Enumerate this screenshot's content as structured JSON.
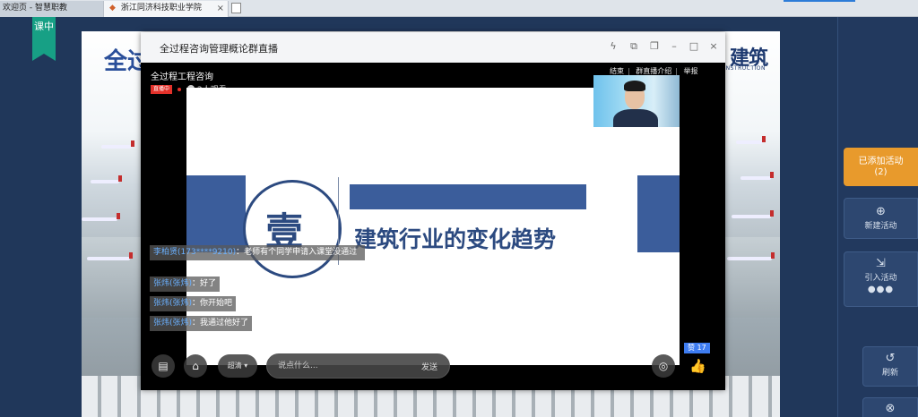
{
  "browser": {
    "tabs": [
      {
        "label": "欢迎页 - 智慧职教"
      },
      {
        "label": "浙江同济科技职业学院",
        "close": "×"
      }
    ]
  },
  "app": {
    "class_badge": "课中"
  },
  "slide_behind": {
    "title": "全过",
    "logo": "建筑",
    "logo_sub": "CONSTRUCTION"
  },
  "live_window": {
    "title": "全过程咨询管理概论群直播",
    "course_name": "全过程工程咨询",
    "live_badge": "直播中",
    "viewers": "2人观看",
    "top_links": [
      "结束",
      "群直播介绍",
      "举报"
    ]
  },
  "shared_slide": {
    "number_char": "壹",
    "heading": "建筑行业的变化趋势"
  },
  "chat": [
    {
      "name": "李柏贤(173****9210)",
      "text": "：老师有个同学申请入课堂没通过"
    },
    {
      "name": "张炜(张炜)",
      "text": "：好了"
    },
    {
      "name": "张炜(张炜)",
      "text": "：你开始吧"
    },
    {
      "name": "张炜(张炜)",
      "text": "：我通过他好了"
    }
  ],
  "controls": {
    "quality": "超清",
    "input_placeholder": "说点什么...",
    "send": "发送",
    "like_count": "赞 17"
  },
  "right_panel": {
    "added_activity": "已添加活动",
    "added_count": "(2)",
    "new_activity": "新建活动",
    "import_activity": "引入活动",
    "refresh": "刷新"
  },
  "colors": {
    "accent_orange": "#e89a2c",
    "live_red": "#e3312a",
    "slide_blue": "#3b5d9b",
    "badge_green": "#17a085"
  }
}
